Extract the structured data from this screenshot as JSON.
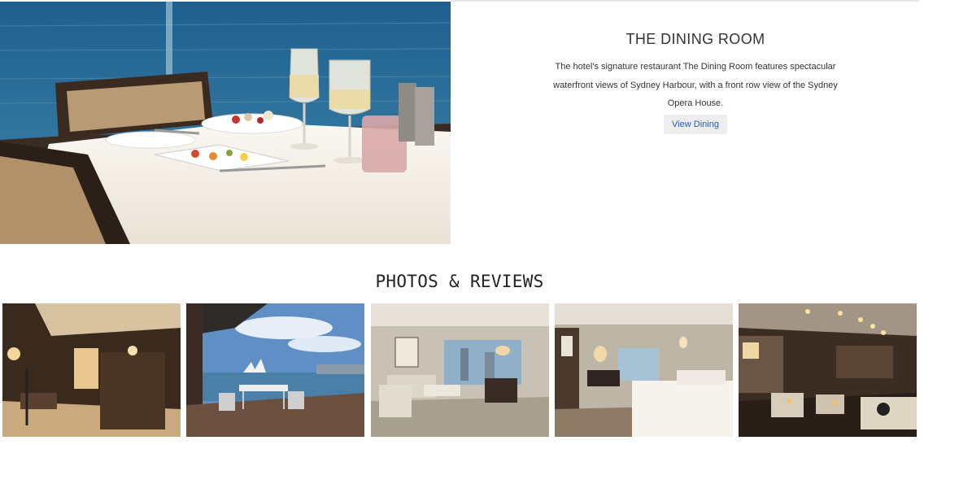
{
  "dining": {
    "title": "THE DINING ROOM",
    "description": "The hotel's signature restaurant The Dining Room features spectacular waterfront views of Sydney Harbour, with a front row view of the Sydney Opera House.",
    "button_label": "View Dining"
  },
  "gallery": {
    "title": "PHOTOS & REVIEWS"
  }
}
